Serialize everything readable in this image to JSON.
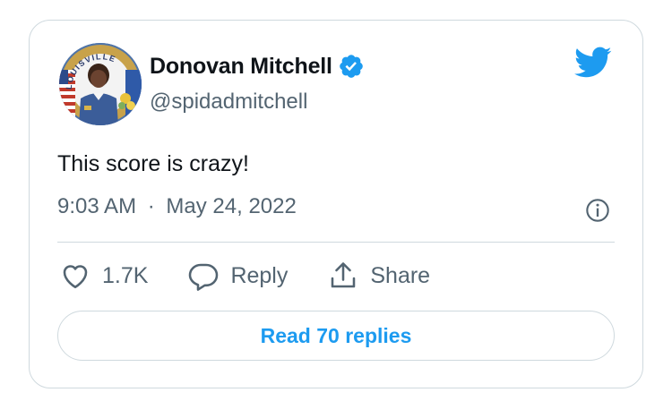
{
  "tweet": {
    "display_name": "Donovan Mitchell",
    "handle": "@spidadmitchell",
    "text": "This score is crazy!",
    "time": "9:03 AM",
    "separator": "·",
    "date": "May 24, 2022",
    "verified": true
  },
  "avatar": {
    "badge_text": "LOUISVILLE"
  },
  "actions": {
    "like_count": "1.7K",
    "reply_label": "Reply",
    "share_label": "Share"
  },
  "read_replies": {
    "label": "Read 70 replies"
  },
  "icons": {
    "twitter_logo": "twitter-bird-icon",
    "verified": "verified-badge-icon",
    "info": "info-icon",
    "like": "heart-icon",
    "reply": "speech-bubble-icon",
    "share": "share-upload-icon"
  },
  "colors": {
    "accent": "#1d9bf0",
    "text_primary": "#0f1419",
    "text_secondary": "#536471",
    "border": "#cfd9de"
  }
}
